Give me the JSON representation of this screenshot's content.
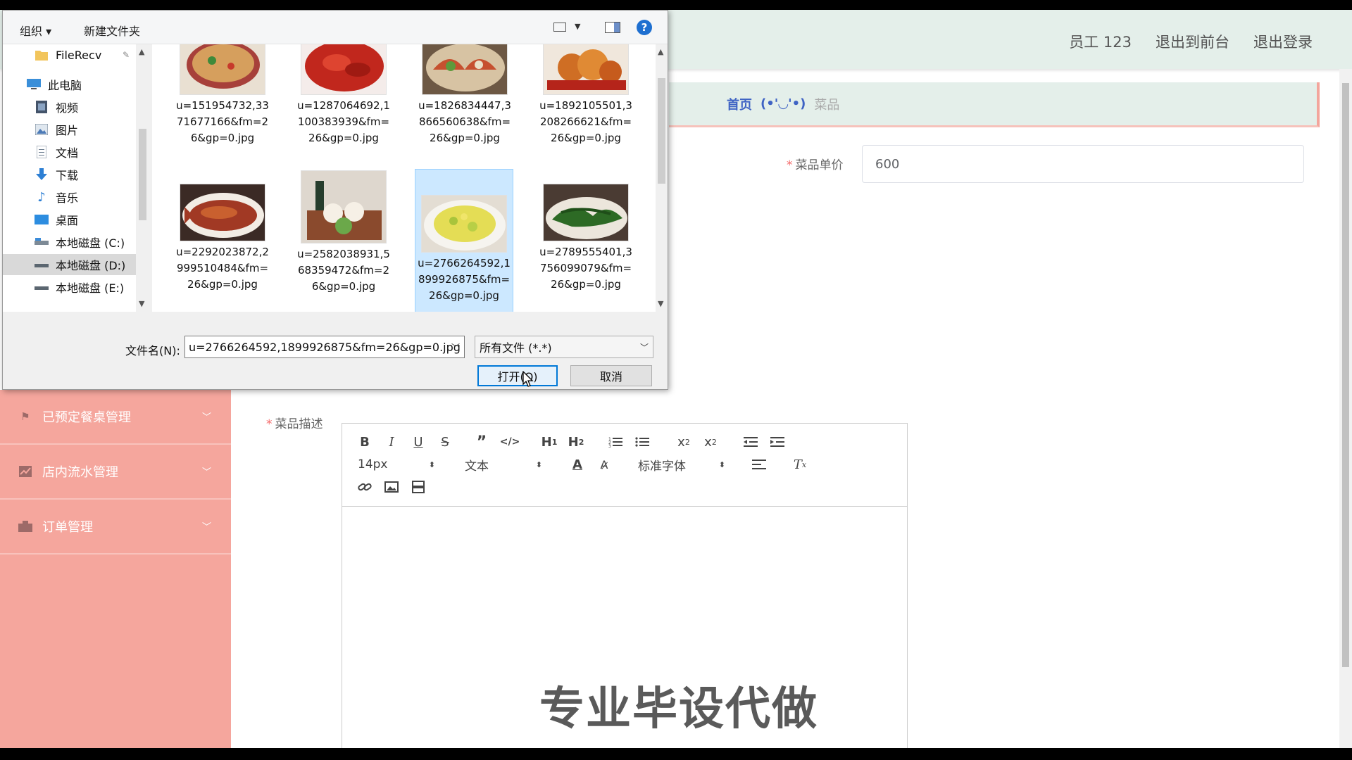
{
  "header": {
    "menu": [
      "员工 123",
      "退出到前台",
      "退出登录"
    ]
  },
  "breadcrumb": {
    "home": "首页",
    "emoticon": "(•'◡'•)",
    "current": "菜品"
  },
  "sidebar": {
    "items": [
      {
        "label": "已预定餐桌管理",
        "icon": "flag-icon"
      },
      {
        "label": "店内流水管理",
        "icon": "chart-icon"
      },
      {
        "label": "订单管理",
        "icon": "order-icon"
      }
    ]
  },
  "form": {
    "price_label": "菜品单价",
    "price_value": "600",
    "desc_label": "菜品描述"
  },
  "editor": {
    "font_size": "14px",
    "header_select": "文本",
    "font_family": "标准字体"
  },
  "watermark": "专业毕设代做",
  "dialog": {
    "toolbar": {
      "organize": "组织 ▾",
      "new_folder": "新建文件夹"
    },
    "nav": [
      {
        "label": "FileRecv",
        "icon": "folder-icon",
        "pinned": true
      },
      {
        "label": "此电脑",
        "icon": "computer-icon"
      },
      {
        "label": "视频",
        "icon": "video-icon"
      },
      {
        "label": "图片",
        "icon": "pictures-icon"
      },
      {
        "label": "文档",
        "icon": "documents-icon"
      },
      {
        "label": "下载",
        "icon": "download-icon"
      },
      {
        "label": "音乐",
        "icon": "music-icon"
      },
      {
        "label": "桌面",
        "icon": "desktop-icon"
      },
      {
        "label": "本地磁盘 (C:)",
        "icon": "drive-icon"
      },
      {
        "label": "本地磁盘 (D:)",
        "icon": "drive-icon",
        "selected": true
      },
      {
        "label": "本地磁盘 (E:)",
        "icon": "drive-icon"
      }
    ],
    "files": [
      {
        "name": "u=151954732,3371677166&fm=26&gp=0.jpg",
        "color": "#c7955d"
      },
      {
        "name": "u=1287064692,1100383939&fm=26&gp=0.jpg",
        "color": "#b5231a"
      },
      {
        "name": "u=1826834447,3866560638&fm=26&gp=0.jpg",
        "color": "#b7925e"
      },
      {
        "name": "u=1892105501,3208266621&fm=26&gp=0.jpg",
        "color": "#d0702c"
      },
      {
        "name": "u=2292023872,2999510484&fm=26&gp=0.jpg",
        "color": "#a34a2c"
      },
      {
        "name": "u=2582038931,568359472&fm=26&gp=0.jpg",
        "color": "#8b6d55"
      },
      {
        "name": "u=2766264592,1899926875&fm=26&gp=0.jpg",
        "color": "#cfd65a",
        "selected": true
      },
      {
        "name": "u=2789555401,3756099079&fm=26&gp=0.jpg",
        "color": "#2f6b28"
      }
    ],
    "filename_label": "文件名(N):",
    "filename_value": "u=2766264592,1899926875&fm=26&gp=0.jpg",
    "filetype_value": "所有文件 (*.*)",
    "open_button": "打开(O)",
    "cancel_button": "取消"
  }
}
